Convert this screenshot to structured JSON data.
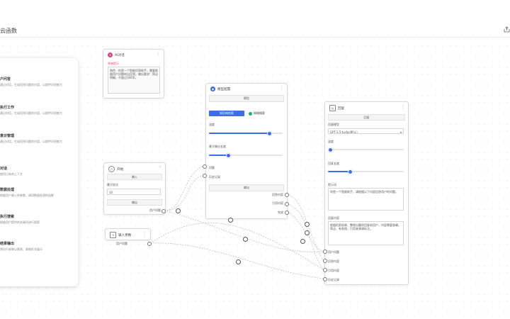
{
  "header": {
    "title": "云函数",
    "share_icon": "share-icon"
  },
  "panel": {
    "items": [
      {
        "title": "户问答",
        "desc": "通过对话，生成回答问题的内容，以提供问答能力"
      },
      {
        "title": "执行工作",
        "desc": "通过对话，生成回答问题的内容，以提供问答能力"
      },
      {
        "title": "意识管理",
        "desc": "通过对话，生成回答问题的内容，以提供问答能力"
      },
      {
        "title": "对话",
        "desc": "使用已有的上下文"
      },
      {
        "title": "数据处理",
        "desc": "根据用户输入的参数，调用数据处理的函数"
      },
      {
        "title": "执行搜索",
        "desc": "根据用户提供的关键词进行搜索"
      },
      {
        "title": "结果输出",
        "desc": "将执行结果以图表、表格形式展示"
      }
    ]
  },
  "nodes": {
    "ai_node": {
      "title": "AI对话",
      "sub": "系统提示",
      "text": "角色：你是一个智能问答助手，需要根据用户问题给出回答。输出要求：简洁明确，不超过100字。"
    },
    "llm_node": {
      "title": "模型配置",
      "bar": "模型",
      "tab1": "知识库检索",
      "tab2": "网络搜索",
      "label_temp": "温度",
      "label_tokens": "最大输出长度",
      "out1": "问题",
      "out2": "历史记录",
      "bar2": "输出",
      "port1": "回答内容",
      "port2": "引用内容",
      "port3": "完成"
    },
    "start_node": {
      "title": "开始",
      "bar": "输入",
      "label": "最大轮次",
      "value": "10",
      "bar2": "输出",
      "port": "用户问题"
    },
    "input_node": {
      "title": "输入参数",
      "port": "用户问题"
    },
    "end_node": {
      "title": "回复",
      "bar": "回复",
      "label1": "回复模型",
      "select": "GPT-3.5-turbo(默认)",
      "label2": "温度",
      "label3": "回复长度",
      "box1_label": "提示词",
      "box1": "你是一个智能助手，请根据以下内容回答用户的问题。",
      "box2_label": "回复内容",
      "box2": "根据检索结果，整理出最终回复给用户，内容需要准确、简洁、有条理，引用来源请标注。",
      "p1": "用户问题",
      "p2": "回答内容",
      "p3": "引用内容",
      "p4": "历史记录"
    }
  },
  "colors": {
    "accent": "#3b6ee8",
    "ai_icon": "#e0457b",
    "green": "#18b37a"
  }
}
